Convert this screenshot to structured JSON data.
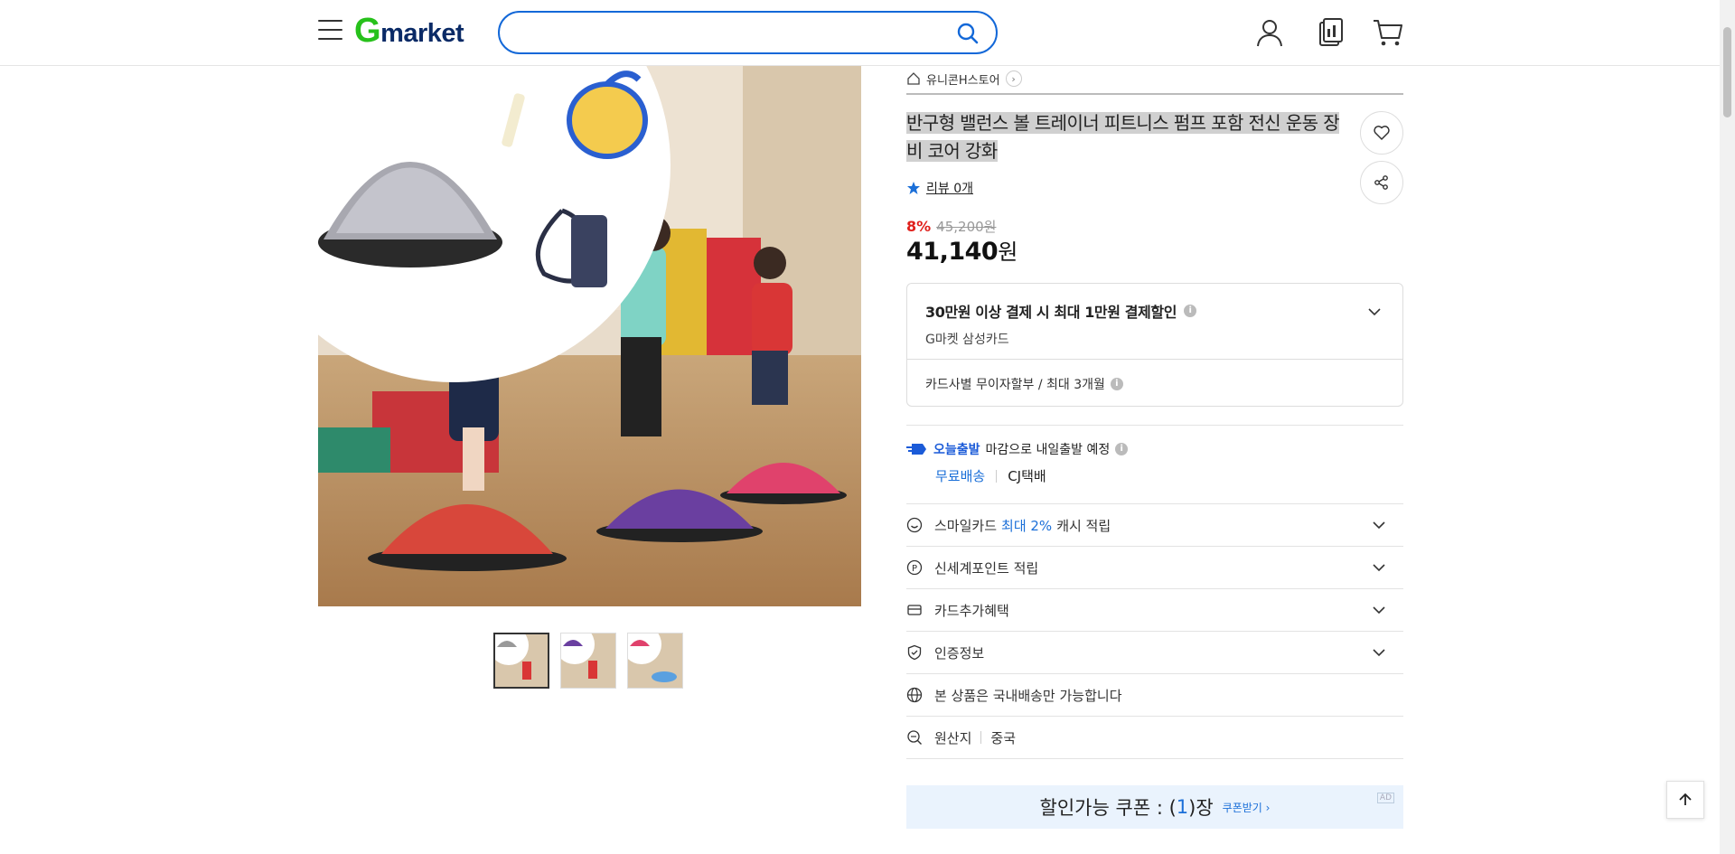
{
  "header": {
    "logo_g": "G",
    "logo_rest": "market",
    "search_placeholder": ""
  },
  "product": {
    "seller": "유니콘H스토어",
    "title": "반구형 밸런스 볼 트레이너 피트니스 펌프 포함 전신 운동 장비 코어 강화",
    "review_label": "리뷰 0개",
    "discount_rate": "8%",
    "original_price": "45,200원",
    "price_number": "41,140",
    "price_unit": "원"
  },
  "card_benefit": {
    "headline": "30만원 이상 결제 시 최대 1만원 결제할인",
    "card_name": "G마켓 삼성카드",
    "installment": "카드사별 무이자할부 / 최대 3개월"
  },
  "shipping": {
    "today_label": "오늘출발",
    "today_text": "마감으로 내일출발 예정",
    "free": "무료배송",
    "carrier": "CJ택배"
  },
  "benefits": [
    {
      "pre": "스마일카드",
      "hl": "최대 2%",
      "post": "캐시 적립"
    },
    {
      "pre": "신세계포인트 적립"
    },
    {
      "pre": "카드추가혜택"
    },
    {
      "pre": "인증정보"
    },
    {
      "pre": "본 상품은 국내배송만 가능합니다"
    }
  ],
  "origin": {
    "label": "원산지",
    "value": "중국"
  },
  "coupon": {
    "prefix": "할인가능 쿠폰 : (",
    "count": "1",
    "suffix": ")장",
    "link": "쿠폰받기 ›",
    "ad": "AD"
  },
  "colors": {
    "accent_blue": "#1368d8",
    "discount_red": "#e0201c",
    "logo_green": "#27c11b"
  }
}
